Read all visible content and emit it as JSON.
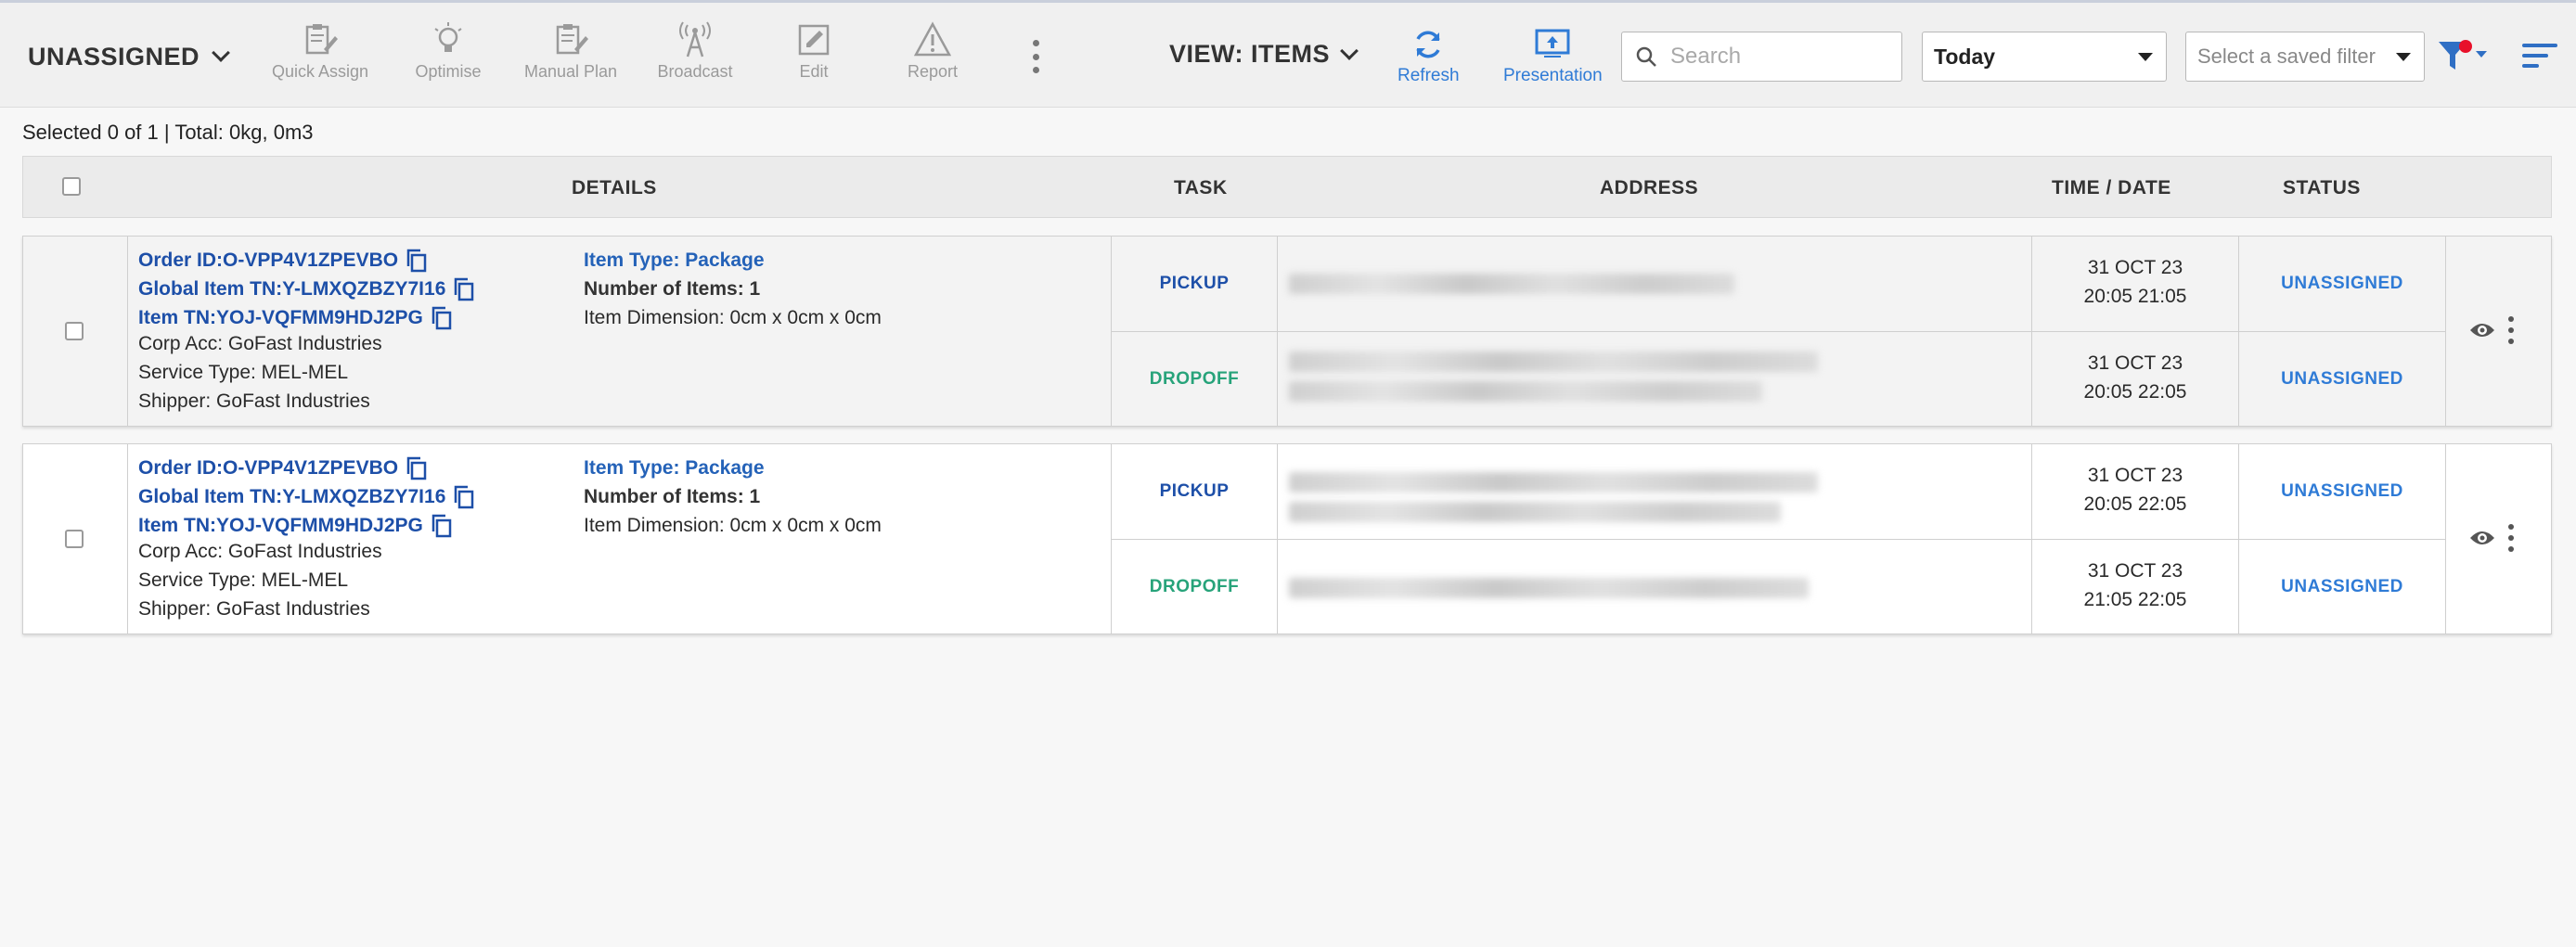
{
  "toolbar": {
    "status_filter": "UNASSIGNED",
    "tools": [
      {
        "label": "Quick Assign",
        "icon": "clipboard-edit-icon"
      },
      {
        "label": "Optimise",
        "icon": "lightbulb-icon"
      },
      {
        "label": "Manual Plan",
        "icon": "clipboard-edit-icon"
      },
      {
        "label": "Broadcast",
        "icon": "radio-tower-icon"
      },
      {
        "label": "Edit",
        "icon": "edit-square-icon"
      },
      {
        "label": "Report",
        "icon": "warning-triangle-icon"
      }
    ],
    "view": "VIEW: ITEMS",
    "refresh_label": "Refresh",
    "presentation_label": "Presentation",
    "search_placeholder": "Search",
    "date_filter": "Today",
    "saved_filter_placeholder": "Select a saved filter"
  },
  "summary": "Selected 0 of 1 | Total: 0kg, 0m3",
  "table": {
    "headers": {
      "details": "DETAILS",
      "task": "TASK",
      "address": "ADDRESS",
      "time_date": "TIME / DATE",
      "status": "STATUS"
    },
    "rows": [
      {
        "order_id": "Order ID:O-VPP4V1ZPEVBO",
        "global_item_tn": "Global Item TN:Y-LMXQZBZY7I16",
        "item_tn": "Item TN:YOJ-VQFMM9HDJ2PG",
        "corp_acc": "Corp Acc: GoFast Industries",
        "service_type": "Service Type: MEL-MEL",
        "shipper": "Shipper: GoFast Industries",
        "item_type": "Item Type: Package",
        "num_items": "Number of Items: 1",
        "item_dimension": "Item Dimension: 0cm x 0cm x 0cm",
        "tasks": [
          {
            "task": "PICKUP",
            "date": "31 OCT 23",
            "time": "20:05 21:05",
            "status": "UNASSIGNED"
          },
          {
            "task": "DROPOFF",
            "date": "31 OCT 23",
            "time": "20:05 22:05",
            "status": "UNASSIGNED"
          }
        ]
      },
      {
        "order_id": "Order ID:O-VPP4V1ZPEVBO",
        "global_item_tn": "Global Item TN:Y-LMXQZBZY7I16",
        "item_tn": "Item TN:YOJ-VQFMM9HDJ2PG",
        "corp_acc": "Corp Acc: GoFast Industries",
        "service_type": "Service Type: MEL-MEL",
        "shipper": "Shipper: GoFast Industries",
        "item_type": "Item Type: Package",
        "num_items": "Number of Items: 1",
        "item_dimension": "Item Dimension: 0cm x 0cm x 0cm",
        "tasks": [
          {
            "task": "PICKUP",
            "date": "31 OCT 23",
            "time": "20:05 22:05",
            "status": "UNASSIGNED"
          },
          {
            "task": "DROPOFF",
            "date": "31 OCT 23",
            "time": "21:05 22:05",
            "status": "UNASSIGNED"
          }
        ]
      }
    ]
  },
  "colors": {
    "link": "#1d4fa8",
    "pickup": "#1d4fa8",
    "dropoff": "#27a37a",
    "status": "#2f7bd6",
    "filter_dot": "#e8102a"
  }
}
